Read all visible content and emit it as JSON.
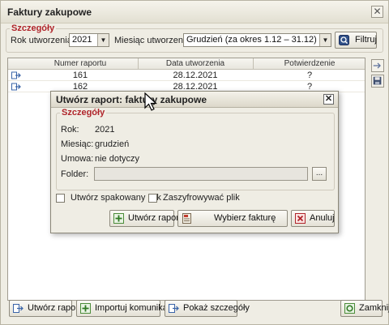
{
  "window": {
    "title": "Faktury zakupowe",
    "close_glyph": "✕"
  },
  "details": {
    "legend": "Szczegóły",
    "year_label": "Rok utworzenia:",
    "year_value": "2021",
    "month_label": "Miesiąc utworzenia:",
    "month_value": "Grudzień (za okres 1.12 – 31.12)",
    "filter_button": "Filtruj"
  },
  "grid": {
    "columns": [
      "Numer raportu",
      "Data utworzenia",
      "Potwierdzenie"
    ],
    "rows": [
      {
        "number": "161",
        "date": "28.12.2021",
        "confirmation": "?"
      },
      {
        "number": "162",
        "date": "28.12.2021",
        "confirmation": "?"
      }
    ]
  },
  "bottom": {
    "create_report": "Utwórz raport",
    "import_message": "Importuj komunikat",
    "show_details": "Pokaż szczegóły",
    "close": "Zamknij"
  },
  "dialog": {
    "title": "Utwórz raport: faktury zakupowe",
    "close_glyph": "✕",
    "legend": "Szczegóły",
    "year_label": "Rok:",
    "year_value": "2021",
    "month_label": "Miesiąc:",
    "month_value": "grudzień",
    "contract_label": "Umowa:",
    "contract_value": "nie dotyczy",
    "folder_label": "Folder:",
    "folder_value": "",
    "browse_glyph": "...",
    "zip_checkbox": "Utwórz spakowany plik",
    "encrypt_checkbox": "Zaszyfrowywać plik",
    "create_button": "Utwórz raport",
    "choose_invoice_button": "Wybierz fakturę",
    "cancel_button": "Anuluj"
  },
  "colors": {
    "legend_red": "#b0252b",
    "window_bg": "#efede4"
  }
}
